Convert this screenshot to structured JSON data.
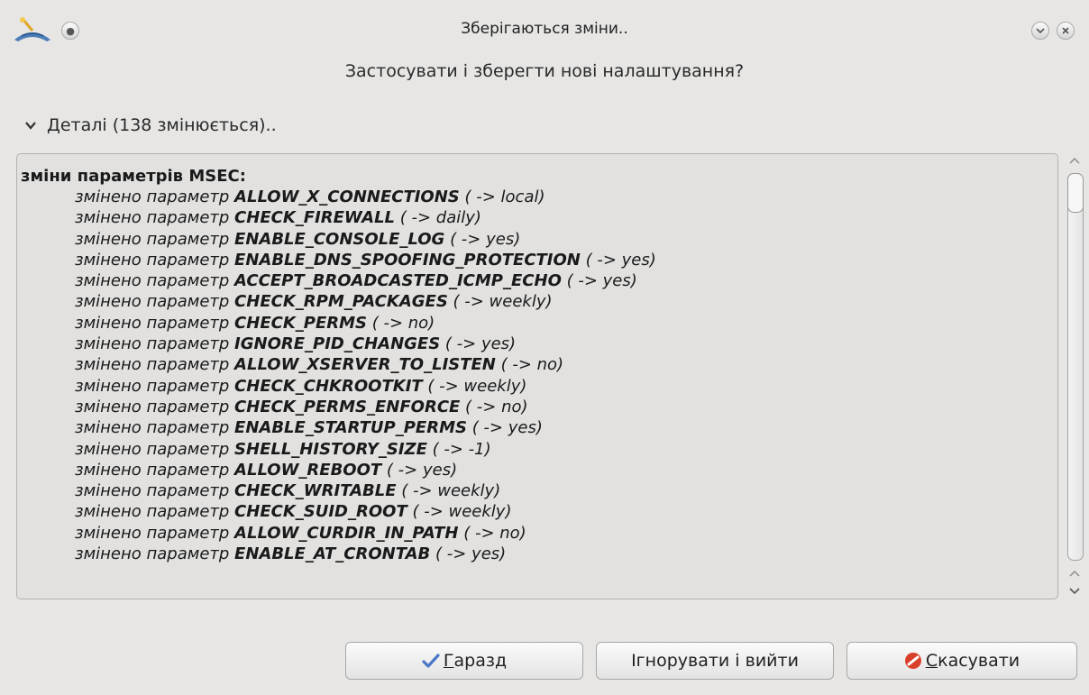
{
  "window": {
    "title": "Зберігаються зміни..",
    "app_icon": "mageia-installer-icon",
    "buttons": [
      "menu-dot-icon",
      "minimize-chevron-icon",
      "close-x-icon"
    ]
  },
  "question": "Застосувати і зберегти нові налаштування?",
  "details": {
    "toggle_label": "Деталі (138 змінюється).."
  },
  "textview": {
    "heading": "зміни параметрів MSEC:",
    "prefix": "змінено параметр",
    "lines": [
      {
        "name": "ALLOW_X_CONNECTIONS",
        "value": "( -> local)"
      },
      {
        "name": "CHECK_FIREWALL",
        "value": "( -> daily)"
      },
      {
        "name": "ENABLE_CONSOLE_LOG",
        "value": "( -> yes)"
      },
      {
        "name": "ENABLE_DNS_SPOOFING_PROTECTION",
        "value": "( -> yes)"
      },
      {
        "name": "ACCEPT_BROADCASTED_ICMP_ECHO",
        "value": "( -> yes)"
      },
      {
        "name": "CHECK_RPM_PACKAGES",
        "value": "( -> weekly)"
      },
      {
        "name": "CHECK_PERMS",
        "value": "( -> no)"
      },
      {
        "name": "IGNORE_PID_CHANGES",
        "value": "( -> yes)"
      },
      {
        "name": "ALLOW_XSERVER_TO_LISTEN",
        "value": "( -> no)"
      },
      {
        "name": "CHECK_CHKROOTKIT",
        "value": "( -> weekly)"
      },
      {
        "name": "CHECK_PERMS_ENFORCE",
        "value": "( -> no)"
      },
      {
        "name": "ENABLE_STARTUP_PERMS",
        "value": "( -> yes)"
      },
      {
        "name": "SHELL_HISTORY_SIZE",
        "value": "( -> -1)"
      },
      {
        "name": "ALLOW_REBOOT",
        "value": "( -> yes)"
      },
      {
        "name": "CHECK_WRITABLE",
        "value": "( -> weekly)"
      },
      {
        "name": "CHECK_SUID_ROOT",
        "value": "( -> weekly)"
      },
      {
        "name": "ALLOW_CURDIR_IN_PATH",
        "value": "( -> no)"
      },
      {
        "name": "ENABLE_AT_CRONTAB",
        "value": "( -> yes)"
      }
    ]
  },
  "buttons": {
    "ok_label": "Гаразд",
    "ok_icon": "checkmark-icon",
    "ignore_label": "Ігнорувати і вийти",
    "cancel_label": "Скасувати",
    "cancel_icon": "cancel-circle-icon"
  },
  "colors": {
    "window_bg": "#e7e6e5",
    "textview_bg": "#e2e1e0",
    "ok_icon": "#4a78c8",
    "cancel_icon": "#d9402b"
  }
}
